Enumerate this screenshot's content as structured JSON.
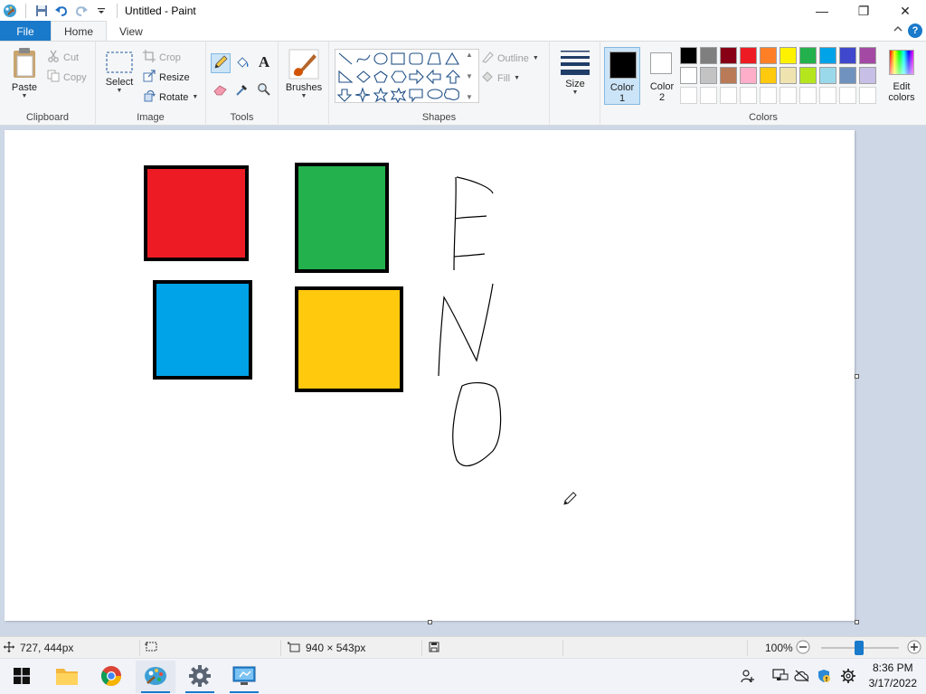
{
  "window": {
    "title": "Untitled - Paint",
    "minimize": "—",
    "maximize": "❐",
    "close": "✕"
  },
  "tabs": {
    "file": "File",
    "home": "Home",
    "view": "View",
    "help": "?"
  },
  "ribbon": {
    "clipboard": {
      "label": "Clipboard",
      "paste": "Paste",
      "cut": "Cut",
      "copy": "Copy"
    },
    "image": {
      "label": "Image",
      "select": "Select",
      "crop": "Crop",
      "resize": "Resize",
      "rotate": "Rotate"
    },
    "tools": {
      "label": "Tools",
      "text_tool": "A"
    },
    "brushes": {
      "label": "Brushes"
    },
    "shapes": {
      "label": "Shapes",
      "outline": "Outline",
      "fill": "Fill"
    },
    "size": {
      "label": "Size"
    },
    "colors": {
      "label": "Colors",
      "color1": "Color",
      "color1_num": "1",
      "color2": "Color",
      "color2_num": "2",
      "edit": "Edit",
      "edit2": "colors",
      "color1_value": "#000000",
      "color2_value": "#ffffff",
      "palette_row1": [
        "#000000",
        "#7f7f7f",
        "#880015",
        "#ed1c24",
        "#ff7f27",
        "#fff200",
        "#22b14c",
        "#00a2e8",
        "#3f48cc",
        "#a349a4"
      ],
      "palette_row2": [
        "#ffffff",
        "#c3c3c3",
        "#b97a57",
        "#ffaec9",
        "#ffc90e",
        "#efe4b0",
        "#b5e61d",
        "#99d9ea",
        "#7092be",
        "#c8bfe7"
      ]
    }
  },
  "canvas": {
    "squares": [
      {
        "name": "red-square",
        "color": "#ed1c24"
      },
      {
        "name": "green-square",
        "color": "#22b14c"
      },
      {
        "name": "blue-square",
        "color": "#00a2e8"
      },
      {
        "name": "yellow-square",
        "color": "#ffc90e"
      }
    ]
  },
  "status": {
    "cursor_pos": "727, 444px",
    "canvas_size": "940 × 543px",
    "zoom": "100%"
  },
  "taskbar": {
    "time": "8:36 PM",
    "date": "3/17/2022"
  }
}
